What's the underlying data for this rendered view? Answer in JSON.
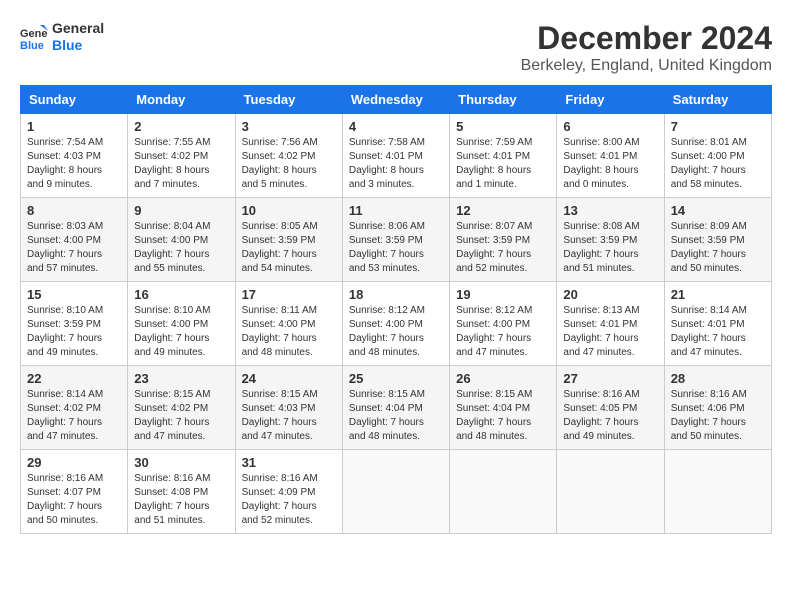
{
  "logo": {
    "general": "General",
    "blue": "Blue"
  },
  "header": {
    "month": "December 2024",
    "location": "Berkeley, England, United Kingdom"
  },
  "weekdays": [
    "Sunday",
    "Monday",
    "Tuesday",
    "Wednesday",
    "Thursday",
    "Friday",
    "Saturday"
  ],
  "weeks": [
    [
      {
        "day": "1",
        "sunrise": "7:54 AM",
        "sunset": "4:03 PM",
        "daylight": "8 hours and 9 minutes."
      },
      {
        "day": "2",
        "sunrise": "7:55 AM",
        "sunset": "4:02 PM",
        "daylight": "8 hours and 7 minutes."
      },
      {
        "day": "3",
        "sunrise": "7:56 AM",
        "sunset": "4:02 PM",
        "daylight": "8 hours and 5 minutes."
      },
      {
        "day": "4",
        "sunrise": "7:58 AM",
        "sunset": "4:01 PM",
        "daylight": "8 hours and 3 minutes."
      },
      {
        "day": "5",
        "sunrise": "7:59 AM",
        "sunset": "4:01 PM",
        "daylight": "8 hours and 1 minute."
      },
      {
        "day": "6",
        "sunrise": "8:00 AM",
        "sunset": "4:01 PM",
        "daylight": "8 hours and 0 minutes."
      },
      {
        "day": "7",
        "sunrise": "8:01 AM",
        "sunset": "4:00 PM",
        "daylight": "7 hours and 58 minutes."
      }
    ],
    [
      {
        "day": "8",
        "sunrise": "8:03 AM",
        "sunset": "4:00 PM",
        "daylight": "7 hours and 57 minutes."
      },
      {
        "day": "9",
        "sunrise": "8:04 AM",
        "sunset": "4:00 PM",
        "daylight": "7 hours and 55 minutes."
      },
      {
        "day": "10",
        "sunrise": "8:05 AM",
        "sunset": "3:59 PM",
        "daylight": "7 hours and 54 minutes."
      },
      {
        "day": "11",
        "sunrise": "8:06 AM",
        "sunset": "3:59 PM",
        "daylight": "7 hours and 53 minutes."
      },
      {
        "day": "12",
        "sunrise": "8:07 AM",
        "sunset": "3:59 PM",
        "daylight": "7 hours and 52 minutes."
      },
      {
        "day": "13",
        "sunrise": "8:08 AM",
        "sunset": "3:59 PM",
        "daylight": "7 hours and 51 minutes."
      },
      {
        "day": "14",
        "sunrise": "8:09 AM",
        "sunset": "3:59 PM",
        "daylight": "7 hours and 50 minutes."
      }
    ],
    [
      {
        "day": "15",
        "sunrise": "8:10 AM",
        "sunset": "3:59 PM",
        "daylight": "7 hours and 49 minutes."
      },
      {
        "day": "16",
        "sunrise": "8:10 AM",
        "sunset": "4:00 PM",
        "daylight": "7 hours and 49 minutes."
      },
      {
        "day": "17",
        "sunrise": "8:11 AM",
        "sunset": "4:00 PM",
        "daylight": "7 hours and 48 minutes."
      },
      {
        "day": "18",
        "sunrise": "8:12 AM",
        "sunset": "4:00 PM",
        "daylight": "7 hours and 48 minutes."
      },
      {
        "day": "19",
        "sunrise": "8:12 AM",
        "sunset": "4:00 PM",
        "daylight": "7 hours and 47 minutes."
      },
      {
        "day": "20",
        "sunrise": "8:13 AM",
        "sunset": "4:01 PM",
        "daylight": "7 hours and 47 minutes."
      },
      {
        "day": "21",
        "sunrise": "8:14 AM",
        "sunset": "4:01 PM",
        "daylight": "7 hours and 47 minutes."
      }
    ],
    [
      {
        "day": "22",
        "sunrise": "8:14 AM",
        "sunset": "4:02 PM",
        "daylight": "7 hours and 47 minutes."
      },
      {
        "day": "23",
        "sunrise": "8:15 AM",
        "sunset": "4:02 PM",
        "daylight": "7 hours and 47 minutes."
      },
      {
        "day": "24",
        "sunrise": "8:15 AM",
        "sunset": "4:03 PM",
        "daylight": "7 hours and 47 minutes."
      },
      {
        "day": "25",
        "sunrise": "8:15 AM",
        "sunset": "4:04 PM",
        "daylight": "7 hours and 48 minutes."
      },
      {
        "day": "26",
        "sunrise": "8:15 AM",
        "sunset": "4:04 PM",
        "daylight": "7 hours and 48 minutes."
      },
      {
        "day": "27",
        "sunrise": "8:16 AM",
        "sunset": "4:05 PM",
        "daylight": "7 hours and 49 minutes."
      },
      {
        "day": "28",
        "sunrise": "8:16 AM",
        "sunset": "4:06 PM",
        "daylight": "7 hours and 50 minutes."
      }
    ],
    [
      {
        "day": "29",
        "sunrise": "8:16 AM",
        "sunset": "4:07 PM",
        "daylight": "7 hours and 50 minutes."
      },
      {
        "day": "30",
        "sunrise": "8:16 AM",
        "sunset": "4:08 PM",
        "daylight": "7 hours and 51 minutes."
      },
      {
        "day": "31",
        "sunrise": "8:16 AM",
        "sunset": "4:09 PM",
        "daylight": "7 hours and 52 minutes."
      },
      null,
      null,
      null,
      null
    ]
  ]
}
